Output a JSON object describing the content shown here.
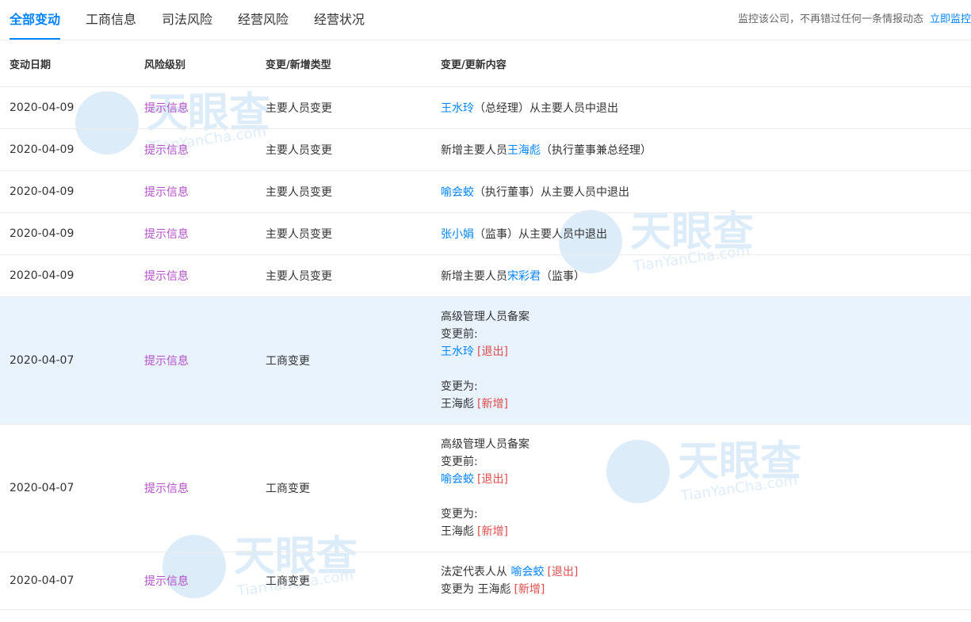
{
  "tabs": [
    {
      "label": "全部变动",
      "active": true
    },
    {
      "label": "工商信息",
      "active": false
    },
    {
      "label": "司法风险",
      "active": false
    },
    {
      "label": "经营风险",
      "active": false
    },
    {
      "label": "经营状况",
      "active": false
    }
  ],
  "promo": {
    "text": "监控该公司，不再错过任何一条情报动态",
    "link": "立即监控"
  },
  "headers": [
    "变动日期",
    "风险级别",
    "变更/新增类型",
    "变更/更新内容"
  ],
  "watermark": {
    "brand": "天眼查",
    "domain": "TianYanCha.com"
  },
  "rows": [
    {
      "date": "2020-04-09",
      "risk": "提示信息",
      "type": "主要人员变更",
      "content": {
        "name": "王水玲",
        "suffix": "（总经理）从主要人员中退出"
      }
    },
    {
      "date": "2020-04-09",
      "risk": "提示信息",
      "type": "主要人员变更",
      "content": {
        "prefix": "新增主要人员",
        "name": "王海彪",
        "suffix": "（执行董事兼总经理）"
      }
    },
    {
      "date": "2020-04-09",
      "risk": "提示信息",
      "type": "主要人员变更",
      "content": {
        "name": "喻会蛟",
        "suffix": "（执行董事）从主要人员中退出"
      }
    },
    {
      "date": "2020-04-09",
      "risk": "提示信息",
      "type": "主要人员变更",
      "content": {
        "name": "张小娟",
        "suffix": "（监事）从主要人员中退出"
      }
    },
    {
      "date": "2020-04-09",
      "risk": "提示信息",
      "type": "主要人员变更",
      "content": {
        "prefix": "新增主要人员",
        "name": "宋彩君",
        "suffix": "（监事）"
      }
    },
    {
      "date": "2020-04-07",
      "risk": "提示信息",
      "type": "工商变更",
      "detail": {
        "title": "高级管理人员备案",
        "before_label": "变更前:",
        "before_name": "王水玲",
        "before_tag": "[退出]",
        "after_label": "变更为:",
        "after_name": "王海彪",
        "after_tag": "[新增]"
      }
    },
    {
      "date": "2020-04-07",
      "risk": "提示信息",
      "type": "工商变更",
      "detail": {
        "title": "高级管理人员备案",
        "before_label": "变更前:",
        "before_name": "喻会蛟",
        "before_tag": "[退出]",
        "after_label": "变更为:",
        "after_name": "王海彪",
        "after_tag": "[新增]"
      }
    },
    {
      "date": "2020-04-07",
      "risk": "提示信息",
      "type": "工商变更",
      "legal": {
        "line1": "法定代表人从",
        "from_name": "喻会蛟",
        "from_tag": "[退出]",
        "line2": "变更为",
        "to_name": "王海彪",
        "to_tag": "[新增]"
      }
    }
  ]
}
